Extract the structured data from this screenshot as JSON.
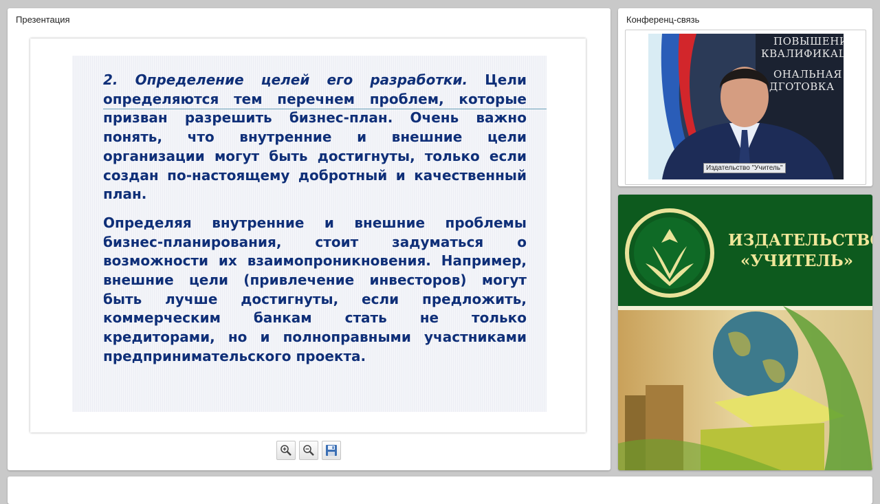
{
  "presentation": {
    "title": "Презентация",
    "slide": {
      "heading_italic": "2. Определение целей его разработки.",
      "paragraph1": " Цели определяются тем перечнем проблем, которые призван разрешить бизнес-план. Очень важно понять, что внутренние и внешние цели организации могут быть достигнуты, только если создан по-настоящему добротный и качественный план.",
      "paragraph2": "Определяя внутренние и внешние проблемы бизнес-планирования, стоит задуматься о возможности их взаимопроникновения. Например, внешние цели (привлечение инвесторов) могут быть лучше достигнуты, если предложить, коммерческим банкам стать не только кредиторами, но и полноправными участниками предпринимательского проекта."
    },
    "toolbar": {
      "zoom_in_icon": "zoom-in-icon",
      "zoom_out_icon": "zoom-out-icon",
      "save_icon": "floppy-disk-icon"
    }
  },
  "conference": {
    "title": "Конференц-связь",
    "video": {
      "caption": "Издательство \"Учитель\"",
      "banner_lines": [
        "ПОВЫШЕНИЕ",
        "КВАЛИФИКАЦИИ",
        "ОНАЛЬНАЯ",
        "ДГОТОВКА"
      ]
    }
  },
  "brand": {
    "name_line1": "ИЗДАТЕЛЬСТВО",
    "name_line2": "«УЧИТЕЛЬ»",
    "background_color": "#0d5a1e",
    "text_color": "#f0e79a"
  }
}
